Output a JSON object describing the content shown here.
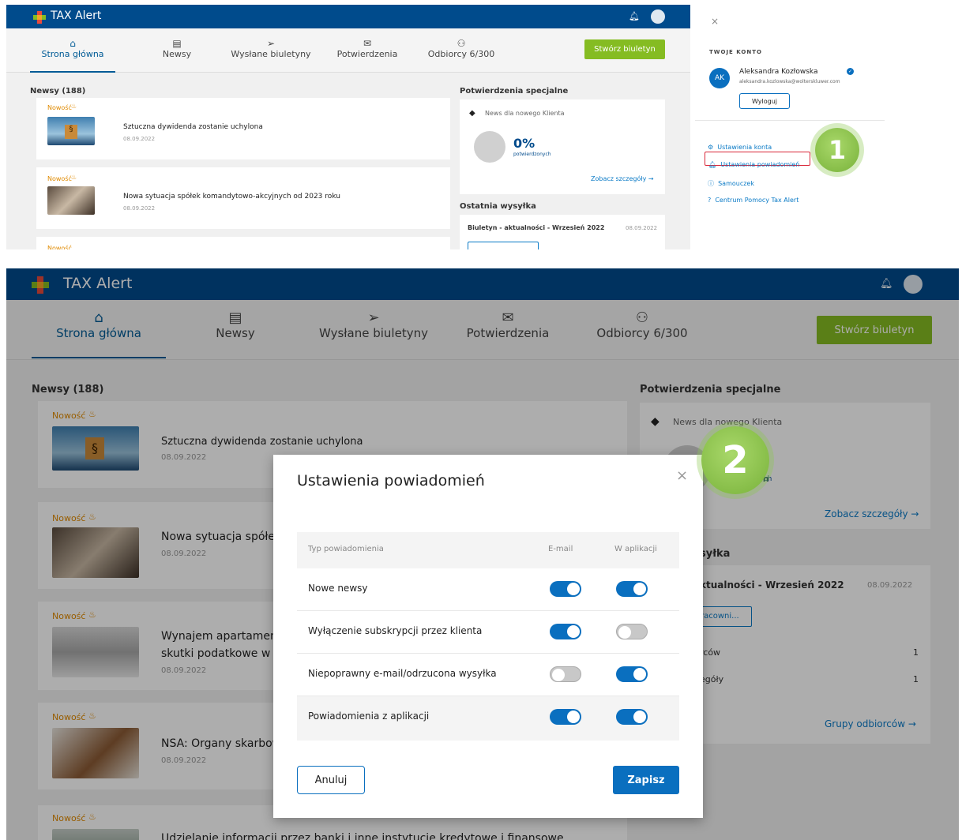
{
  "app": {
    "title": "TAX Alert",
    "avatar_initials": "AK"
  },
  "nav": {
    "home": "Strona główna",
    "news": "Newsy",
    "sent": "Wysłane biuletyny",
    "confirmations": "Potwierdzenia",
    "recipients": "Odbiorcy 6/300",
    "create_button": "Stwórz biuletyn"
  },
  "news": {
    "heading": "Newsy (188)",
    "badge": "Nowość",
    "items": [
      {
        "title": "Sztuczna dywidenda zostanie uchylona",
        "date": "08.09.2022"
      },
      {
        "title": "Nowa sytuacja spółek komandytowo-akcyjnych od 2023 roku",
        "date": "08.09.2022"
      },
      {
        "title": "Wynajem apartament",
        "title2": "skutki podatkowe w V",
        "date": "08.09.2022"
      },
      {
        "title": "NSA: Organy skarbowe",
        "date": "08.09.2022"
      },
      {
        "title": "Udzielanie informacji przez banki i inne instytucje kredytowe i finansowe",
        "date": ""
      }
    ],
    "bottom_title": "Nowa sytuacja spółek"
  },
  "special": {
    "heading": "Potwierdzenia specjalne",
    "item_title": "News dla nowego Klienta",
    "percent": "0%",
    "percent_label": "potwierdzonych",
    "details_link": "Zobacz szczegóły →",
    "details_link_bottom": "Zobacz szczegóły →"
  },
  "last_send": {
    "heading": "Ostatnia wysyłka",
    "heading_bottom": "syłka",
    "title": "Biuletyn - aktualności - Wrzesień 2022",
    "title_bottom": "ktualności - Wrzesień 2022",
    "date": "08.09.2022",
    "button_bottom": "racowni...",
    "row1_label": "rców",
    "row1_value": "1",
    "row2_label": "egóły",
    "row2_value": "1",
    "groups_link": "Grupy odbiorców →"
  },
  "account": {
    "section_title": "TWOJE KONTO",
    "name": "Aleksandra Kozłowska",
    "email": "aleksandra.kozlowska@wolterskluwer.com",
    "logout": "Wyloguj",
    "menu": [
      {
        "label": "Ustawienia konta"
      },
      {
        "label": "Ustawienia powiadomień"
      },
      {
        "label": "Samouczek"
      },
      {
        "label": "Centrum Pomocy Tax Alert"
      }
    ]
  },
  "modal": {
    "title": "Ustawienia powiadomień",
    "col_type": "Typ powiadomienia",
    "col_email": "E-mail",
    "col_app": "W aplikacji",
    "rows": [
      {
        "label": "Nowe newsy",
        "email": true,
        "app": true
      },
      {
        "label": "Wyłączenie subskrypcji przez klienta",
        "email": true,
        "app": false
      },
      {
        "label": "Niepoprawny e-mail/odrzucona wysyłka",
        "email": false,
        "app": true
      },
      {
        "label": "Powiadomienia z aplikacji",
        "email": true,
        "app": true
      }
    ],
    "cancel": "Anuluj",
    "save": "Zapisz"
  },
  "callouts": {
    "one": "1",
    "two": "2"
  },
  "colors": {
    "header": "#004b8c",
    "accent": "#0a6fbf",
    "green": "#85bc22",
    "new_badge": "#e08a00"
  }
}
